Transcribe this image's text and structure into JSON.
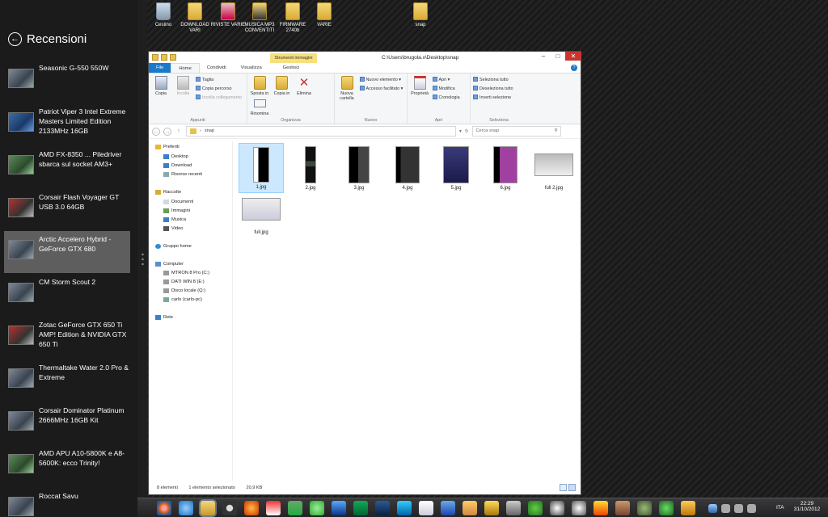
{
  "snap_panel": {
    "title": "Recensioni",
    "items": [
      {
        "label": "Seasonic G-550 550W",
        "selected": false
      },
      {
        "label": "Patriot Viper 3 Intel Extreme Masters Limited Edition 2133MHz 16GB",
        "selected": false
      },
      {
        "label": "AMD FX-8350 ... Piledriver sbarca sul socket AM3+",
        "selected": false
      },
      {
        "label": "Corsair Flash Voyager GT USB 3.0 64GB",
        "selected": false
      },
      {
        "label": "Arctic Accelero Hybrid - GeForce GTX 680",
        "selected": true
      },
      {
        "label": "CM Storm Scout 2",
        "selected": false
      },
      {
        "label": "Zotac GeForce GTX 650 Ti AMP! Edition & NVIDIA GTX 650 Ti",
        "selected": false
      },
      {
        "label": "Thermaltake Water 2.0 Pro & Extreme",
        "selected": false
      },
      {
        "label": "Corsair Dominator Platinum 2666MHz 16GB Kit",
        "selected": false
      },
      {
        "label": "AMD APU A10-5800K e A8-5600K: ecco Trinity!",
        "selected": false
      },
      {
        "label": "Roccat Savu",
        "selected": false
      }
    ]
  },
  "desktop_icons": [
    "Cestino",
    "DOWNLOAD VARI",
    "RIVISTE VARIE",
    "MUSICA MP3 CONVENTITI",
    "FIRMWARE 2740b",
    "VARIE",
    "snap"
  ],
  "explorer": {
    "title_path": "C:\\Users\\brugola.x\\Desktop\\snap",
    "context_tab": "Strumenti immagini",
    "tabs": [
      "File",
      "Home",
      "Condividi",
      "Visualizza",
      "Gestisci"
    ],
    "ribbon": {
      "appunti": {
        "copia": "Copia",
        "incolla": "Incolla",
        "taglia": "Taglia",
        "copia_percorso": "Copia percorso",
        "incolla_collegamento": "Incolla collegamento",
        "name": "Appunti"
      },
      "organizza": {
        "sposta": "Sposta in",
        "copia_in": "Copia in",
        "elimina": "Elimina",
        "rinomina": "Rinomina",
        "name": "Organizza"
      },
      "nuovo": {
        "nuova_cartella": "Nuova cartella",
        "nuovo_elemento": "Nuovo elemento",
        "accesso_facilitato": "Accesso facilitato",
        "name": "Nuovo"
      },
      "apri": {
        "proprieta": "Proprietà",
        "apri": "Apri",
        "modifica": "Modifica",
        "cronologia": "Cronologia",
        "name": "Apri"
      },
      "seleziona": {
        "tutto": "Seleziona tutto",
        "deseleziona": "Deseleziona tutto",
        "inverti": "Inverti selezione",
        "name": "Seleziona"
      }
    },
    "address": "snap",
    "search_placeholder": "Cerca snap",
    "nav": {
      "preferiti": "Preferiti",
      "desktop": "Desktop",
      "download": "Download",
      "risorse": "Risorse recenti",
      "raccolte": "Raccolte",
      "documenti": "Documenti",
      "immagini": "Immagini",
      "musica": "Musica",
      "video": "Video",
      "gruppo": "Gruppo home",
      "computer": "Computer",
      "mtron": "MTRON 8 Pro (C:)",
      "dati": "DATI WIN 8 (E:)",
      "disco": "Disco locale (Q:)",
      "carlo": "carlo (carlo-pc)",
      "rete": "Rete"
    },
    "files": [
      {
        "name": "1.jpg",
        "selected": true
      },
      {
        "name": "2.jpg",
        "selected": false
      },
      {
        "name": "3.jpg",
        "selected": false
      },
      {
        "name": "4.jpg",
        "selected": false
      },
      {
        "name": "5.jpg",
        "selected": false
      },
      {
        "name": "6.jpg",
        "selected": false
      },
      {
        "name": "full 2.jpg",
        "selected": false
      },
      {
        "name": "full.jpg",
        "selected": false
      }
    ],
    "status": {
      "count": "8 elementi",
      "selection": "1 elemento selezionato",
      "size": "20,9 KB"
    }
  },
  "taskbar": {
    "lang": "ITA",
    "time": "22:29",
    "date": "31/10/2012"
  }
}
